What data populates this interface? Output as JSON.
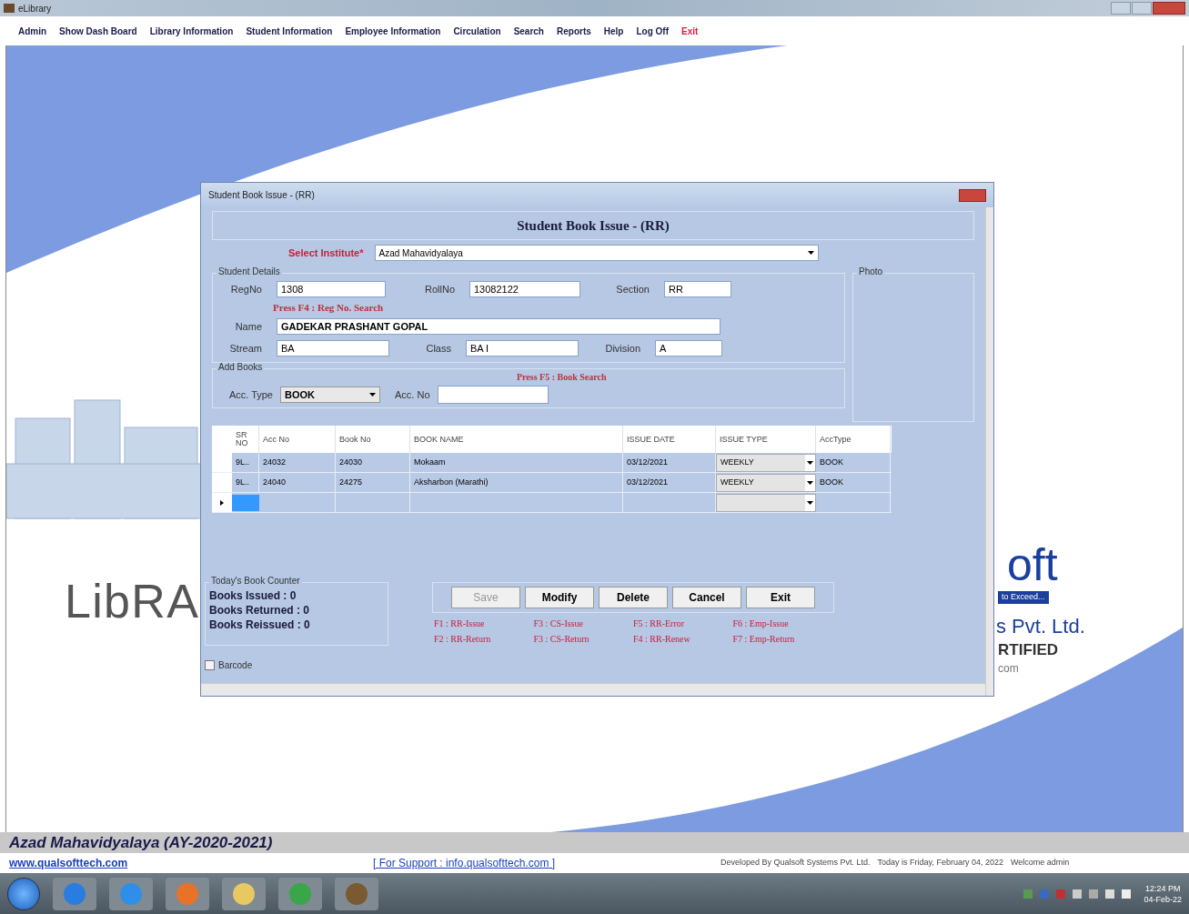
{
  "app_title": "eLibrary",
  "menu": [
    {
      "label": "Admin",
      "kind": "normal"
    },
    {
      "label": "Show Dash Board",
      "kind": "normal"
    },
    {
      "label": "Library Information",
      "kind": "normal"
    },
    {
      "label": "Student Information",
      "kind": "normal"
    },
    {
      "label": "Employee Information",
      "kind": "normal"
    },
    {
      "label": "Circulation",
      "kind": "normal"
    },
    {
      "label": "Search",
      "kind": "normal"
    },
    {
      "label": "Reports",
      "kind": "normal"
    },
    {
      "label": "Help",
      "kind": "normal"
    },
    {
      "label": "Log Off",
      "kind": "normal"
    },
    {
      "label": "Exit",
      "kind": "exit"
    }
  ],
  "backdrop": {
    "logo_left": "LibRA",
    "logo_right": "oft",
    "tagline": "to Exceed...",
    "company": "s Pvt. Ltd.",
    "certified": "RTIFIED",
    "site": "com"
  },
  "dialog": {
    "title": "Student Book Issue - (RR)",
    "heading": "Student Book Issue - (RR)",
    "institute": {
      "label": "Select Institute*",
      "value": "Azad Mahavidyalaya"
    },
    "student_details": {
      "legend": "Student Details",
      "regno": {
        "label": "RegNo",
        "value": "1308"
      },
      "rollno": {
        "label": "RollNo",
        "value": "13082122"
      },
      "section": {
        "label": "Section",
        "value": "RR"
      },
      "hint": "Press F4 : Reg No. Search",
      "name": {
        "label": "Name",
        "value": "GADEKAR PRASHANT GOPAL"
      },
      "stream": {
        "label": "Stream",
        "value": "BA"
      },
      "class": {
        "label": "Class",
        "value": "BA I"
      },
      "division": {
        "label": "Division",
        "value": "A"
      }
    },
    "photo": {
      "legend": "Photo"
    },
    "add_books": {
      "legend": "Add Books",
      "hint": "Press F5 : Book Search",
      "acc_type": {
        "label": "Acc. Type",
        "value": "BOOK"
      },
      "acc_no": {
        "label": "Acc. No"
      }
    },
    "grid": {
      "columns": [
        "SR NO",
        "Acc No",
        "Book No",
        "BOOK NAME",
        "ISSUE DATE",
        "ISSUE TYPE",
        "AccType"
      ],
      "rows": [
        {
          "cells": [
            "9L..",
            "24032",
            "24030",
            "Mokaam",
            "03/12/2021",
            "WEEKLY",
            "BOOK"
          ],
          "new": false
        },
        {
          "cells": [
            "9L..",
            "24040",
            "24275",
            "Aksharbon (Marathi)",
            "03/12/2021",
            "WEEKLY",
            "BOOK"
          ],
          "new": false
        },
        {
          "cells": [],
          "new": true
        }
      ]
    },
    "counter": {
      "legend": "Today's Book Counter",
      "lines": [
        "Books Issued : 0",
        "Books Returned : 0",
        "Books Reissued : 0"
      ]
    },
    "buttons": [
      {
        "label": "Save",
        "disabled": true
      },
      {
        "label": "Modify",
        "disabled": false
      },
      {
        "label": "Delete",
        "disabled": false
      },
      {
        "label": "Cancel",
        "disabled": false
      },
      {
        "label": "Exit",
        "disabled": false
      }
    ],
    "shortcuts": [
      "F1 : RR-Issue",
      "F3 : CS-Issue",
      "F5 : RR-Error",
      "F6 : Emp-Issue",
      "F2 : RR-Return",
      "F3 : CS-Return",
      "F4 : RR-Renew",
      "F7 : Emp-Return"
    ],
    "barcode": {
      "label": "Barcode",
      "checked": false
    }
  },
  "status": {
    "college": "Azad Mahavidyalaya (AY-2020-2021)",
    "website": "www.qualsofttech.com",
    "support": "[ For Support : info.qualsofttech.com ]",
    "developer": "Developed By Qualsoft Systems Pvt. Ltd.",
    "today": "Today is Friday, February 04, 2022",
    "welcome": "Welcome admin"
  },
  "taskbar": {
    "time": "12:24 PM",
    "date": "04-Feb-22"
  }
}
